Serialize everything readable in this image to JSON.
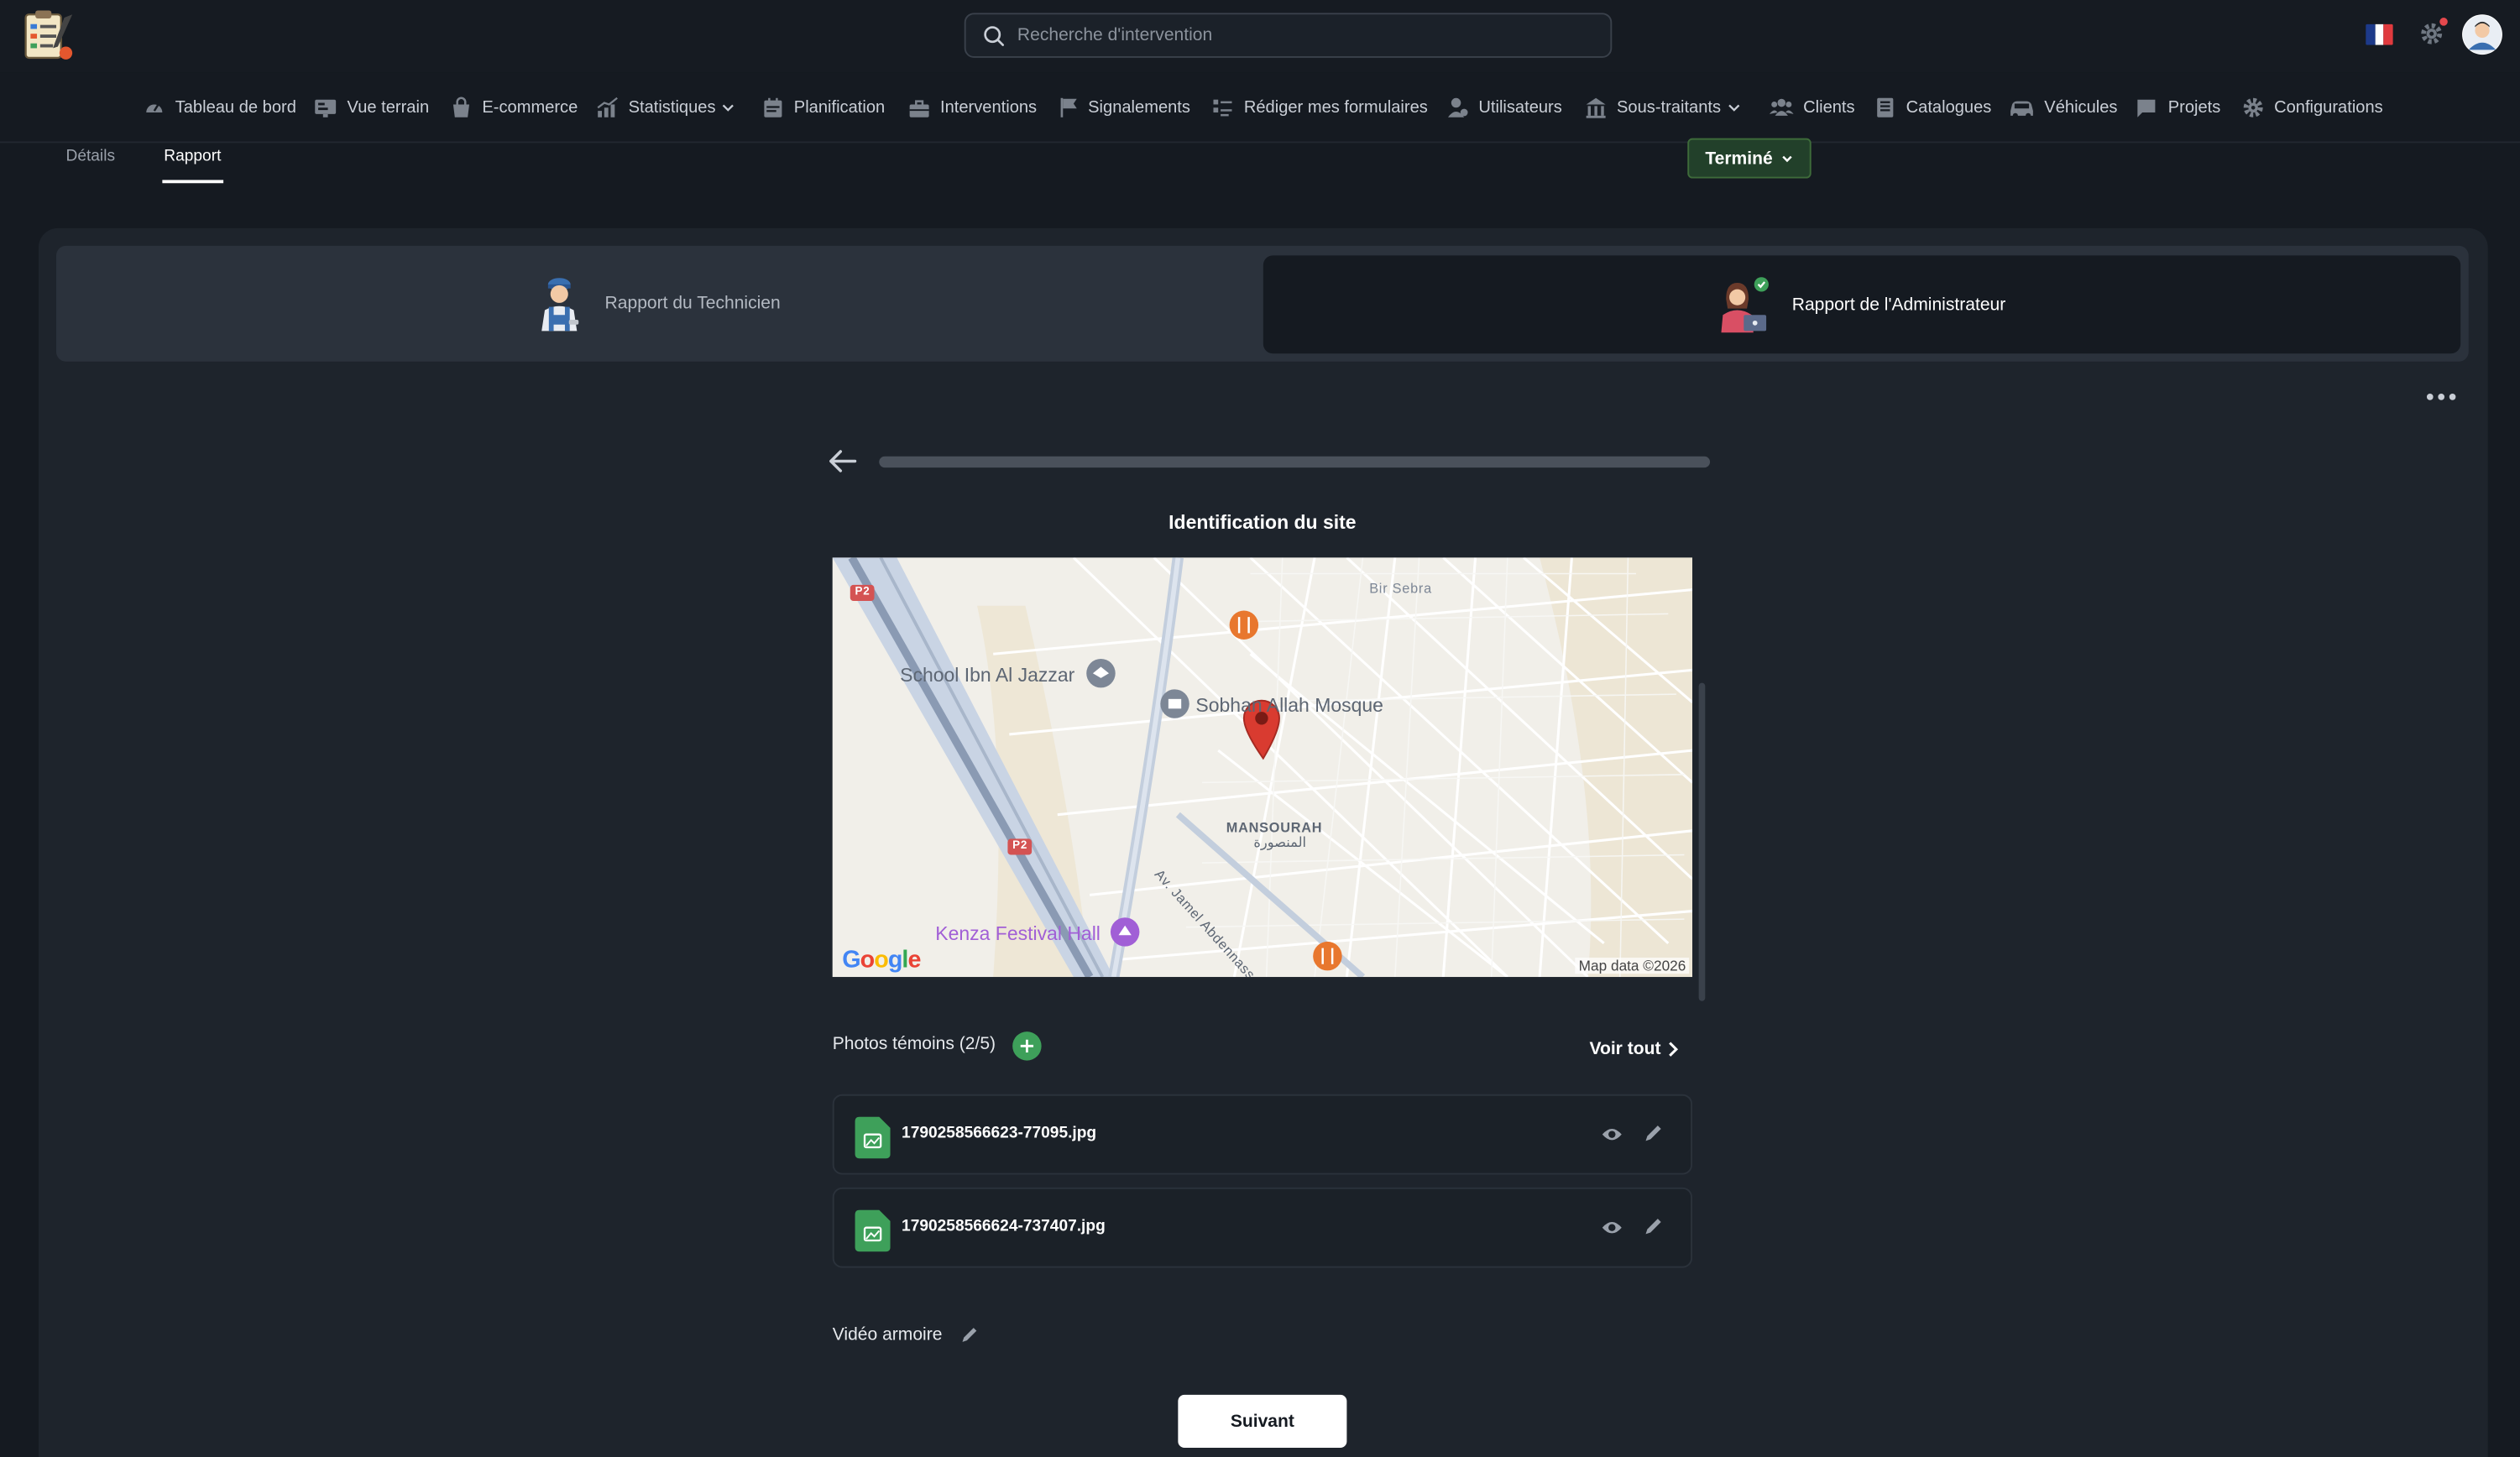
{
  "search": {
    "placeholder": "Recherche d'intervention"
  },
  "nav": {
    "items": [
      {
        "label": "Tableau de bord",
        "icon": "gauge-icon"
      },
      {
        "label": "Vue terrain",
        "icon": "map-board-icon"
      },
      {
        "label": "E-commerce",
        "icon": "shopping-bag-icon"
      },
      {
        "label": "Statistiques",
        "icon": "chart-icon",
        "dropdown": true
      },
      {
        "label": "Planification",
        "icon": "calendar-icon"
      },
      {
        "label": "Interventions",
        "icon": "toolbox-icon"
      },
      {
        "label": "Signalements",
        "icon": "flag-icon"
      },
      {
        "label": "Rédiger mes formulaires",
        "icon": "form-icon"
      },
      {
        "label": "Utilisateurs",
        "icon": "user-icon"
      },
      {
        "label": "Sous-traitants",
        "icon": "building-icon",
        "dropdown": true
      },
      {
        "label": "Clients",
        "icon": "people-icon"
      },
      {
        "label": "Catalogues",
        "icon": "book-icon"
      },
      {
        "label": "Véhicules",
        "icon": "car-icon"
      },
      {
        "label": "Projets",
        "icon": "folder-icon"
      },
      {
        "label": "Configurations",
        "icon": "gear-icon"
      }
    ]
  },
  "tabs": {
    "details": "Détails",
    "report": "Rapport"
  },
  "status": {
    "label": "Terminé"
  },
  "report_switch": {
    "technician": "Rapport du Technicien",
    "admin": "Rapport de l'Administrateur"
  },
  "form": {
    "progress": 0.0,
    "section_title": "Identification du site",
    "map": {
      "labels": {
        "school": "School Ibn Al Jazzar",
        "mosque": "Sobhan Allah Mosque",
        "bir_sebra": "Bir Sebra",
        "mansourah": "MANSOURAH",
        "mansourah_ar": "المنصورة",
        "avenue": "Av. Jamel Abdennasser",
        "kenza": "Kenza Festival Hall",
        "p2_a": "P2",
        "p2_b": "P2"
      },
      "credit": "Map data ©2026",
      "brand": "Google"
    },
    "photos": {
      "label": "Photos témoins (2/5)",
      "see_all": "Voir tout",
      "files": [
        {
          "name": "1790258566623-77095.jpg"
        },
        {
          "name": "1790258566624-737407.jpg"
        }
      ]
    },
    "video_label": "Vidéo armoire",
    "next_label": "Suivant"
  },
  "colors": {
    "background": "#151a21",
    "card": "#1e242c",
    "accent_green": "#3ea05a",
    "status_green": "#22402a",
    "map_pin": "#d93b30"
  }
}
